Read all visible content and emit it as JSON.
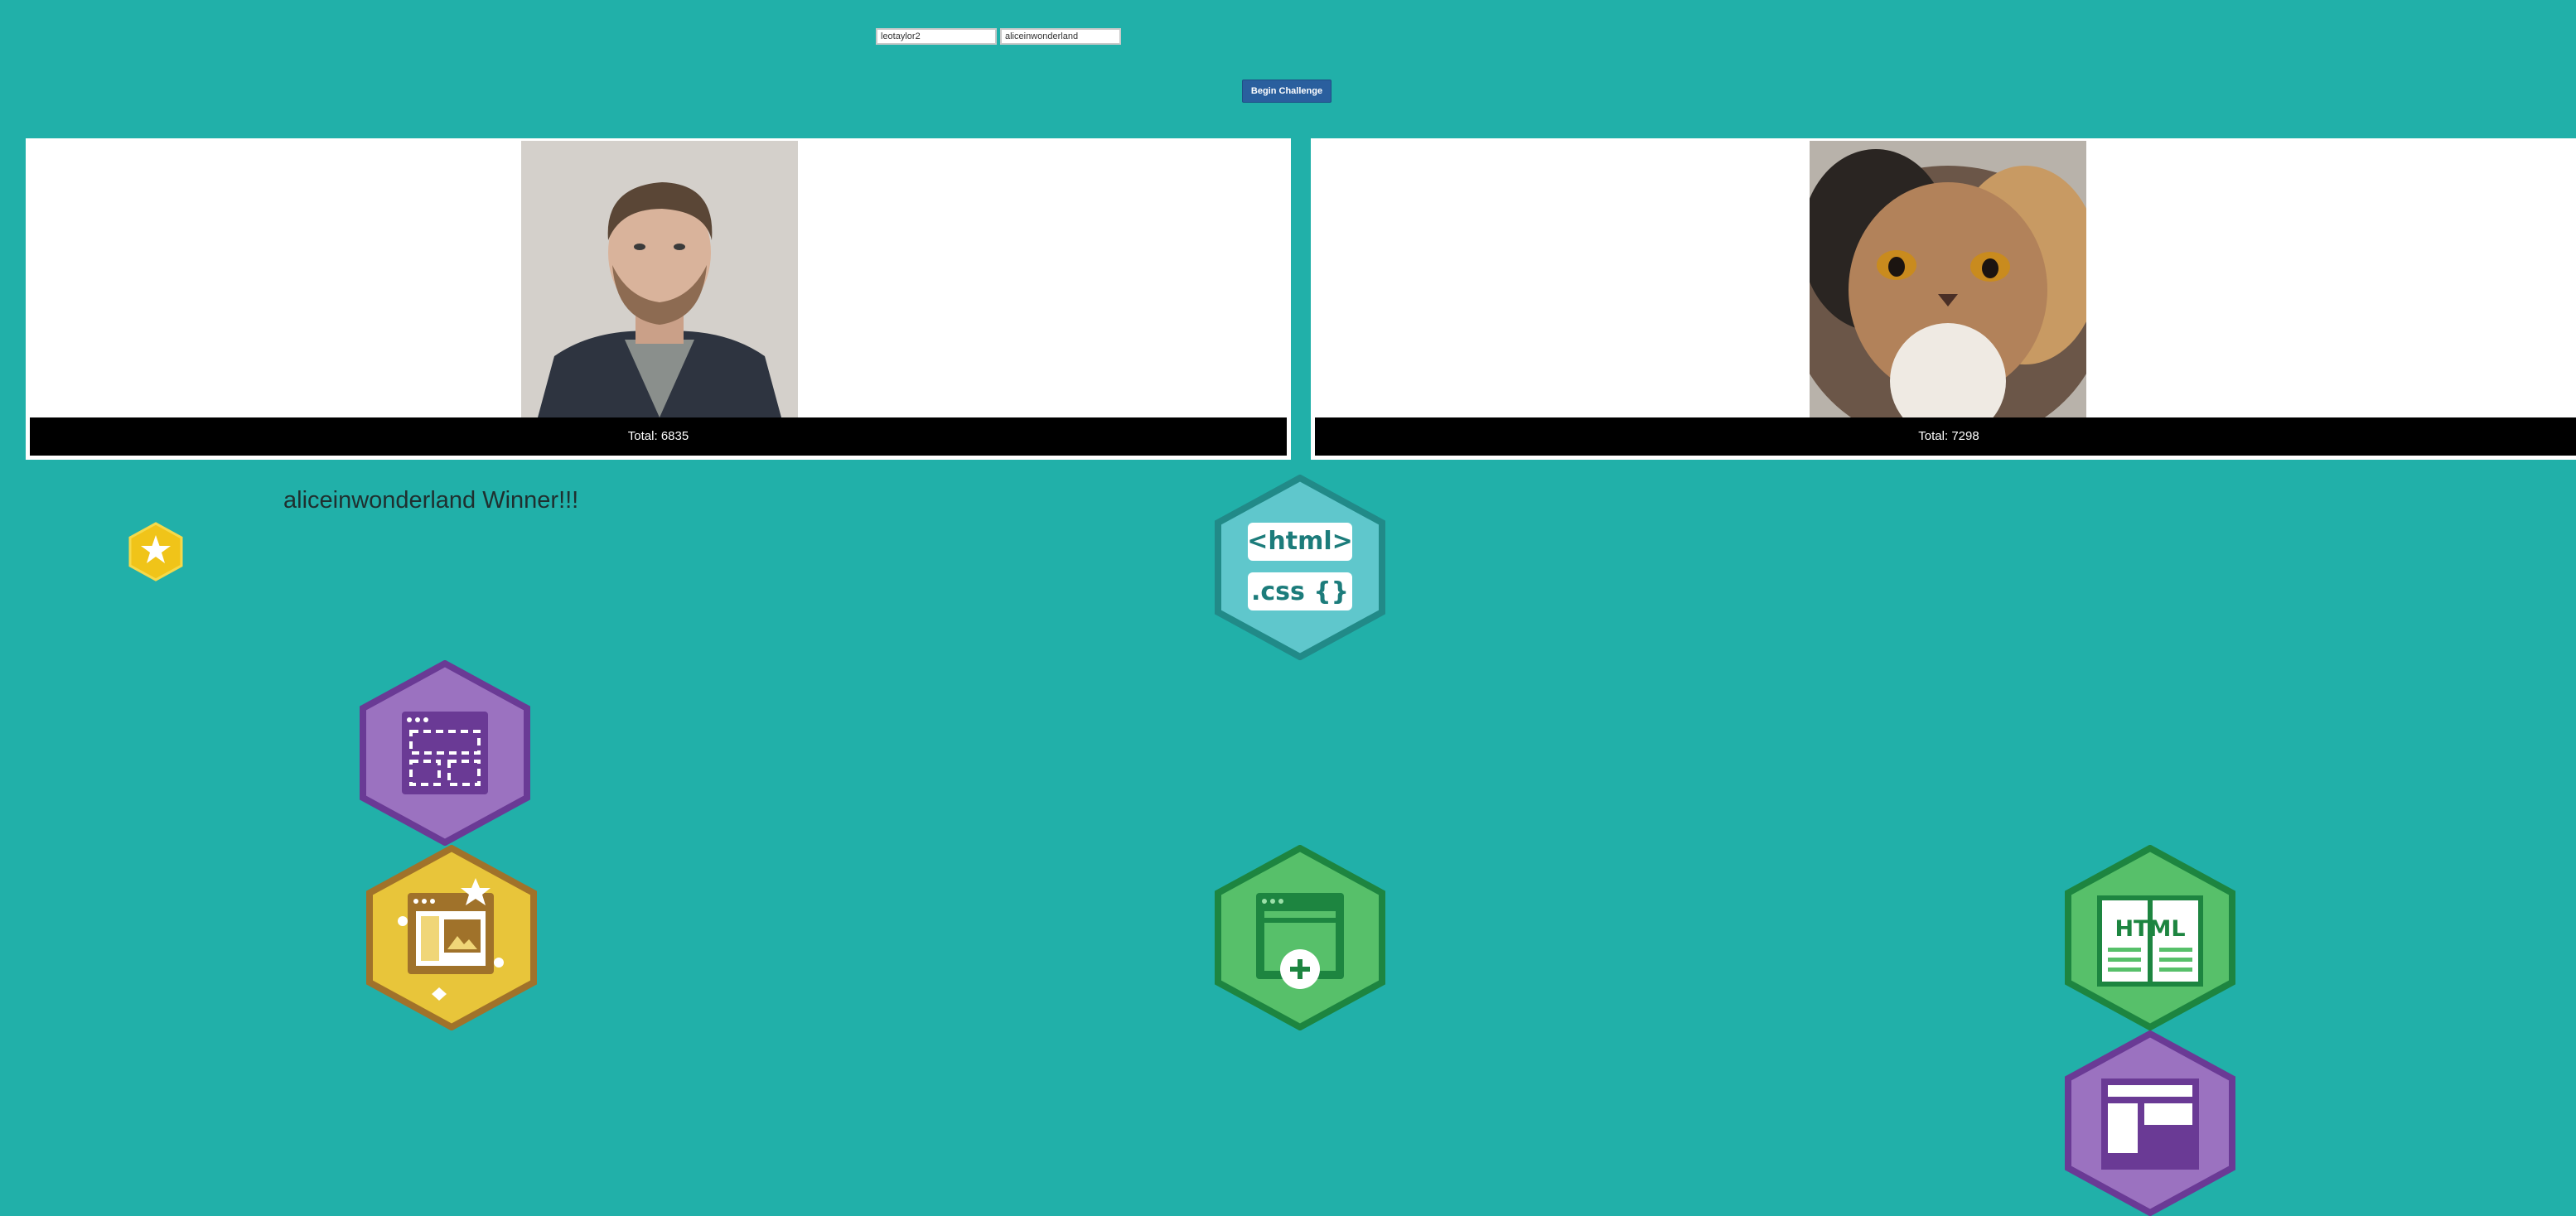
{
  "inputs": {
    "player1": "leotaylor2",
    "player2": "aliceinwonderland"
  },
  "begin_button": "Begin Challenge",
  "cards": [
    {
      "total": "Total: 6835",
      "photo_subject": "man-portrait"
    },
    {
      "total": "Total: 7298",
      "photo_subject": "persian-cat"
    }
  ],
  "winner_text": "aliceinwonderland Winner!!!",
  "badges": {
    "star_small": "star-badge-icon",
    "html_css": {
      "line1": "<html>",
      "line2": ".css {}"
    },
    "layout": "layout-badge-icon",
    "gallery": "gallery-badge-icon",
    "add_page": "add-page-badge-icon",
    "html_book": {
      "label": "HTML"
    },
    "partial": "layout-partial-badge-icon"
  },
  "colors": {
    "background": "#21b0a9",
    "button": "#2a5f9e",
    "card_footer": "#000000"
  }
}
